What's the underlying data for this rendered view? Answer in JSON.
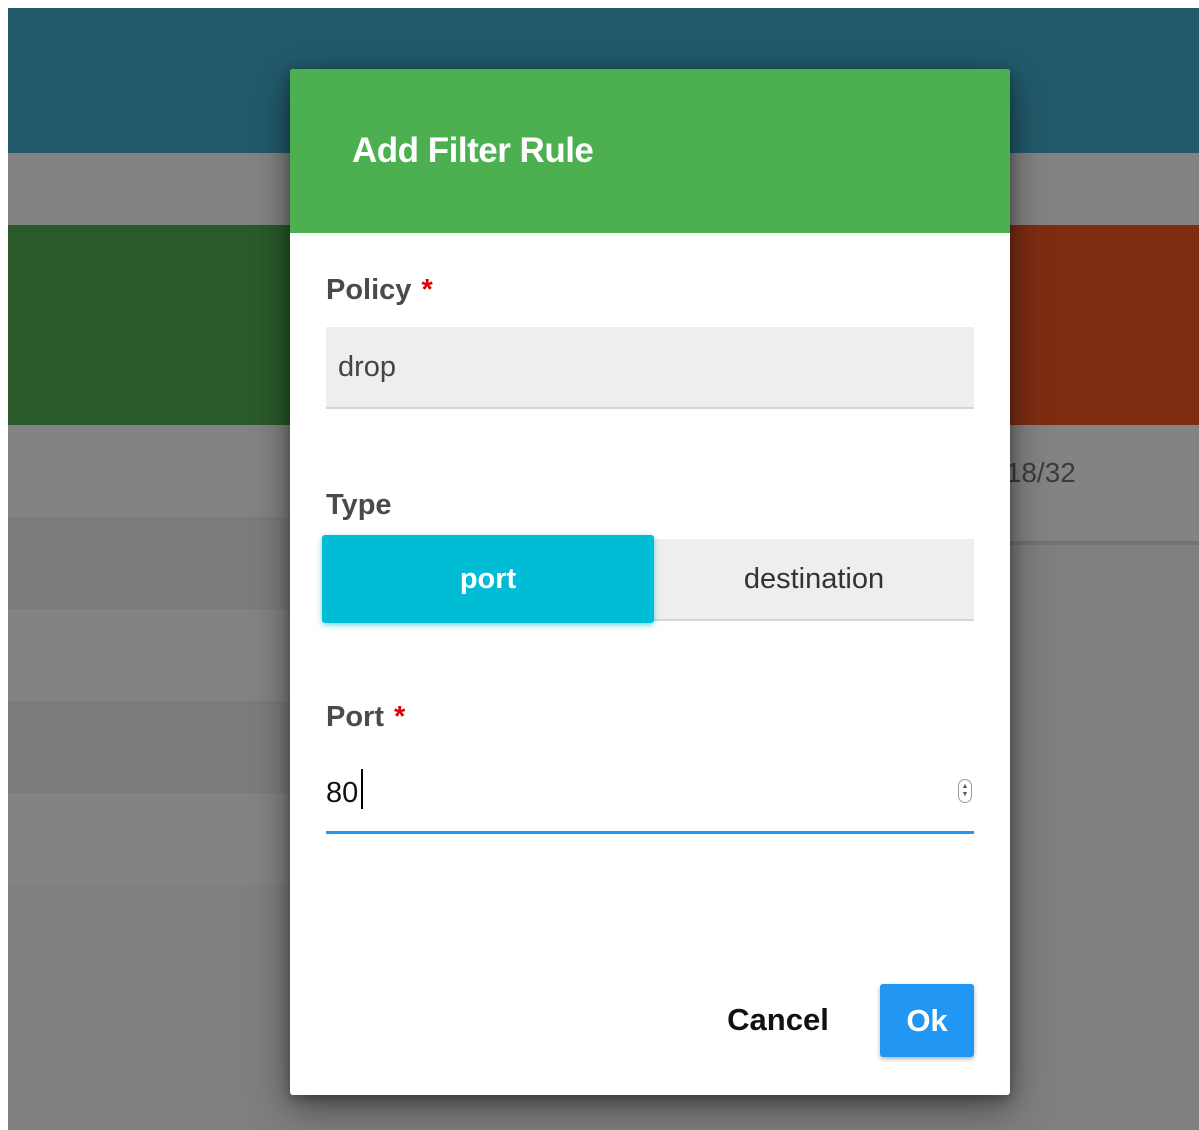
{
  "background": {
    "right_row_text": ".18/32",
    "colors": {
      "overlay": "#7f7f7f",
      "topbar": "#225a6b",
      "green_card": "#2a5a2a",
      "orange_card": "#7f2d12"
    }
  },
  "dialog": {
    "title": "Add Filter Rule",
    "header_color": "#4caf50",
    "policy": {
      "label": "Policy",
      "required_mark": "*",
      "value": "drop"
    },
    "type": {
      "label": "Type",
      "options": [
        "port",
        "destination"
      ],
      "selected": "port",
      "active_color": "#00bcd4"
    },
    "port": {
      "label": "Port",
      "required_mark": "*",
      "value": "80",
      "spinner_icon": "number-spinner-icon",
      "focus_color": "#2196f3"
    },
    "actions": {
      "cancel_label": "Cancel",
      "ok_label": "Ok",
      "ok_color": "#2196f3"
    }
  }
}
